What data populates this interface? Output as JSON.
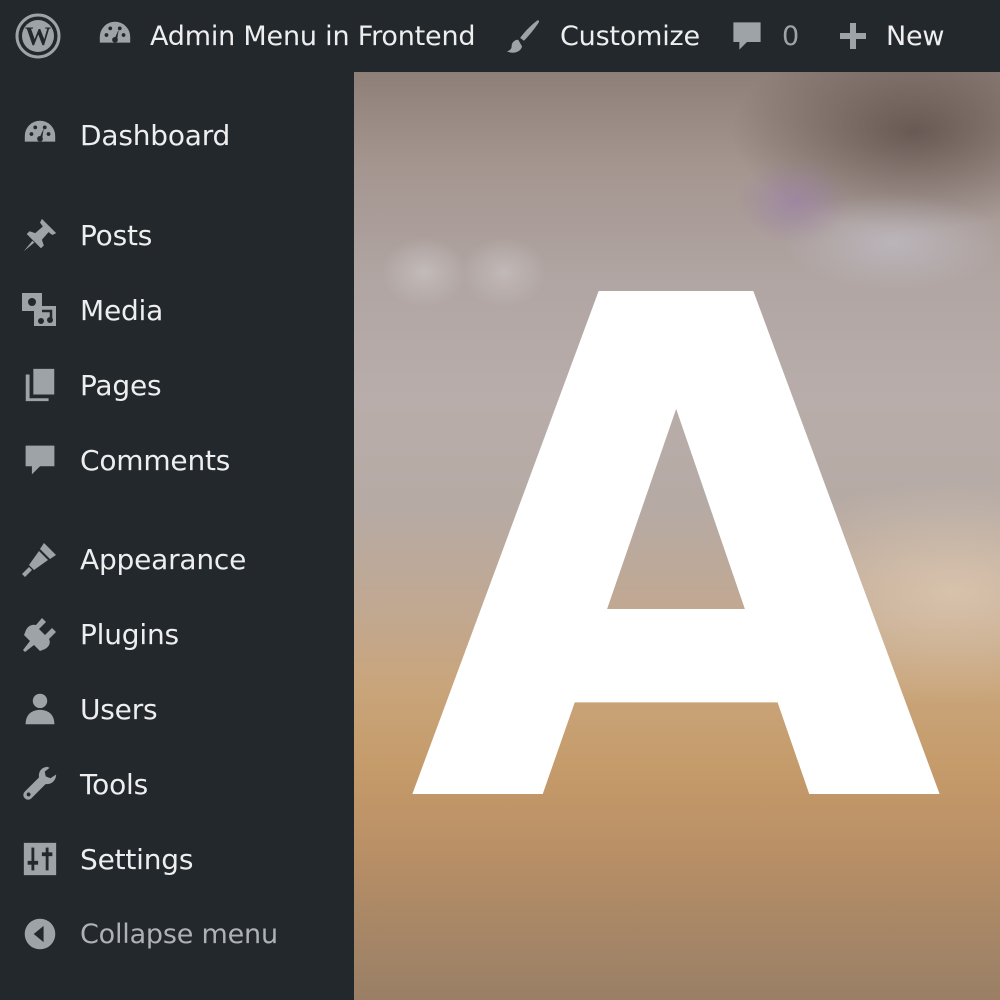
{
  "adminbar": {
    "wp_logo_icon": "wordpress-logo-icon",
    "site_name": "Admin Menu in Frontend",
    "site_icon": "dashboard-gauge-icon",
    "customize_label": "Customize",
    "customize_icon": "paintbrush-icon",
    "comments_count": "0",
    "comments_icon": "comment-bubble-icon",
    "new_label": "New",
    "new_icon": "plus-icon"
  },
  "sidebar": {
    "items": [
      {
        "label": "Dashboard",
        "icon": "dashboard-gauge-icon"
      },
      {
        "label": "Posts",
        "icon": "pushpin-icon"
      },
      {
        "label": "Media",
        "icon": "media-icon"
      },
      {
        "label": "Pages",
        "icon": "pages-icon"
      },
      {
        "label": "Comments",
        "icon": "comment-bubble-icon"
      },
      {
        "label": "Appearance",
        "icon": "paintbrush-icon"
      },
      {
        "label": "Plugins",
        "icon": "plugin-icon"
      },
      {
        "label": "Users",
        "icon": "user-icon"
      },
      {
        "label": "Tools",
        "icon": "wrench-icon"
      },
      {
        "label": "Settings",
        "icon": "settings-sliders-icon"
      }
    ],
    "collapse_label": "Collapse menu",
    "collapse_icon": "collapse-arrow-icon"
  },
  "content": {
    "hero_letter": "A"
  },
  "colors": {
    "bar_bg": "#23282d",
    "icon_gray": "#9ea3a8",
    "text": "#eeeeee"
  }
}
